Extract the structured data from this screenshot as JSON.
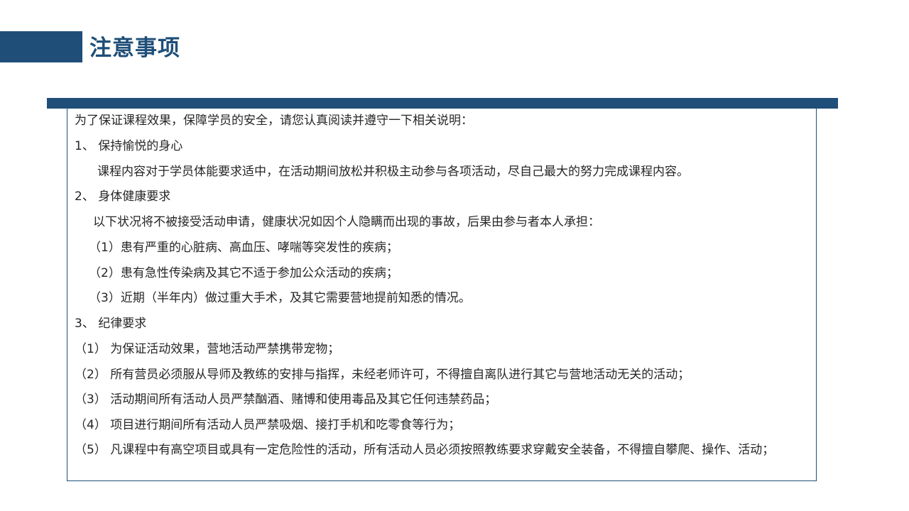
{
  "page": {
    "title": "注意事项"
  },
  "notice": {
    "intro": "为了保证课程效果，保障学员的安全，请您认真阅读并遵守一下相关说明：",
    "section1_heading": "1、 保持愉悦的身心",
    "section1_body": "课程内容对于学员体能要求适中，在活动期间放松并积极主动参与各项活动，尽自己最大的努力完成课程内容。",
    "section2_heading": "2、 身体健康要求",
    "section2_intro": "以下状况将不被接受活动申请，健康状况如因个人隐瞒而出现的事故，后果由参与者本人承担：",
    "section2_items": [
      "（1）患有严重的心脏病、高血压、哮喘等突发性的疾病；",
      "（2）患有急性传染病及其它不适于参加公众活动的疾病；",
      "（3）近期（半年内）做过重大手术，及其它需要营地提前知悉的情况。"
    ],
    "section3_heading": "3、 纪律要求",
    "section3_items": [
      "（1） 为保证活动效果，营地活动严禁携带宠物；",
      "（2） 所有营员必须服从导师及教练的安排与指挥，未经老师许可，不得擅自离队进行其它与营地活动无关的活动；",
      "（3） 活动期间所有活动人员严禁酗酒、赌博和使用毒品及其它任何违禁药品；",
      "（4） 项目进行期间所有活动人员严禁吸烟、接打手机和吃零食等行为；",
      "（5） 凡课程中有高空项目或具有一定危险性的活动，所有活动人员必须按照教练要求穿戴安全装备，不得擅自攀爬、操作、活动；"
    ]
  },
  "colors": {
    "accent": "#1f4e79",
    "text": "#262626"
  }
}
